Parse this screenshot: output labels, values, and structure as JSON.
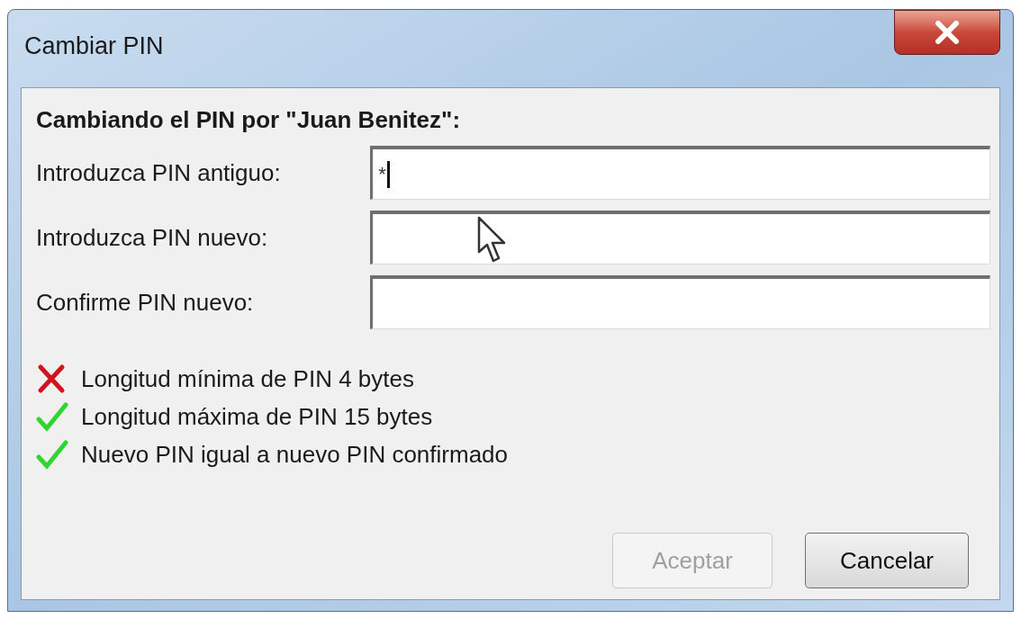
{
  "window": {
    "title": "Cambiar PIN"
  },
  "heading": "Cambiando el PIN por \"Juan Benitez\":",
  "fields": [
    {
      "label": "Introduzca PIN antiguo:",
      "value": "*",
      "focused": true
    },
    {
      "label": "Introduzca PIN nuevo:",
      "focused": false
    },
    {
      "label": "Confirme PIN nuevo:",
      "focused": false
    }
  ],
  "rules": [
    {
      "text": "Longitud mínima de PIN 4 bytes",
      "passed": false
    },
    {
      "text": "Longitud máxima de PIN 15 bytes",
      "passed": true
    },
    {
      "text": "Nuevo PIN igual a nuevo PIN confirmado",
      "passed": true
    }
  ],
  "buttons": [
    {
      "label": "Aceptar",
      "disabled": true
    },
    {
      "label": "Cancelar",
      "disabled": false
    }
  ]
}
